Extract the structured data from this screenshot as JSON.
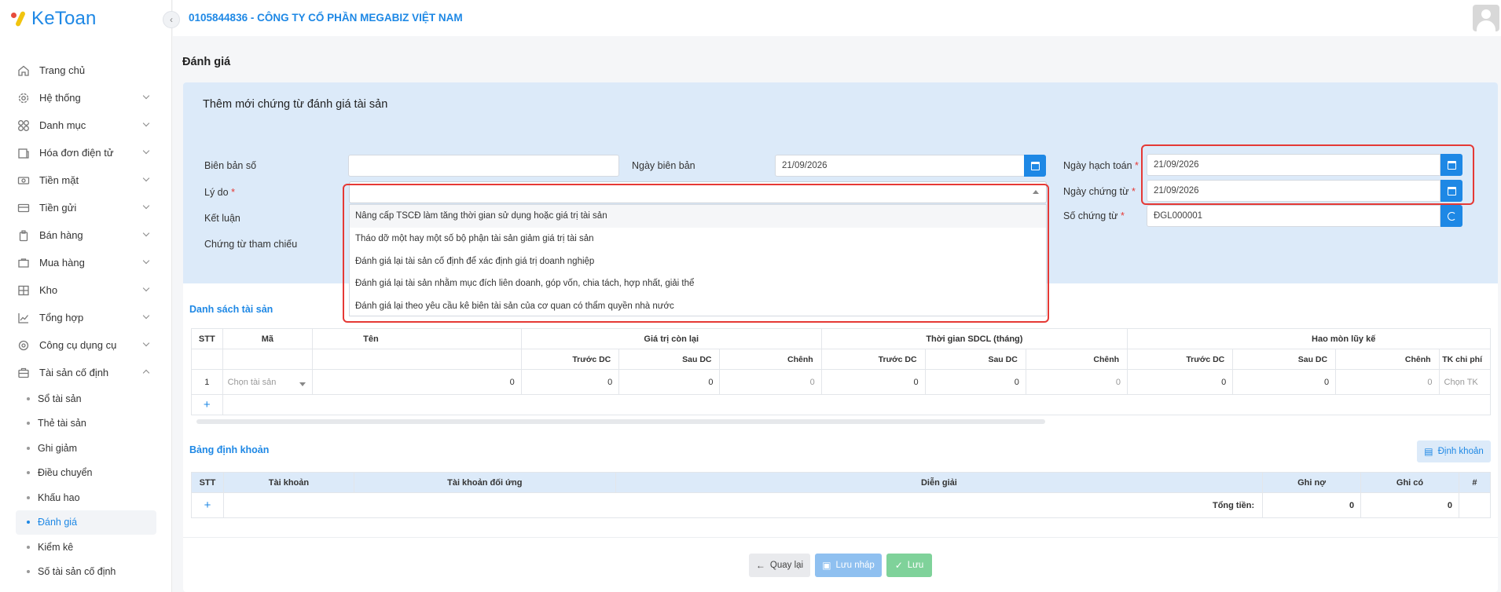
{
  "app": {
    "logo_text": "KeToan"
  },
  "header": {
    "company": "0105844836 - CÔNG TY CỔ PHẦN MEGABIZ VIỆT NAM"
  },
  "sidebar": {
    "items": [
      {
        "label": "Trang chủ",
        "icon": "home-icon"
      },
      {
        "label": "Hệ thống",
        "icon": "gear-icon"
      },
      {
        "label": "Danh mục",
        "icon": "grid-icon"
      },
      {
        "label": "Hóa đơn điện tử",
        "icon": "invoice-icon"
      },
      {
        "label": "Tiền mặt",
        "icon": "cash-icon"
      },
      {
        "label": "Tiền gửi",
        "icon": "card-icon"
      },
      {
        "label": "Bán hàng",
        "icon": "sales-icon"
      },
      {
        "label": "Mua hàng",
        "icon": "cart-icon"
      },
      {
        "label": "Kho",
        "icon": "warehouse-icon"
      },
      {
        "label": "Tổng hợp",
        "icon": "chart-icon"
      },
      {
        "label": "Công cụ dụng cụ",
        "icon": "tools-icon"
      },
      {
        "label": "Tài sản cố định",
        "icon": "asset-icon"
      }
    ],
    "subitems": [
      "Sổ tài sản",
      "Thẻ tài sản",
      "Ghi giảm",
      "Điều chuyển",
      "Khấu hao",
      "Đánh giá",
      "Kiểm kê",
      "Số tài sản cố định"
    ]
  },
  "page": {
    "title": "Đánh giá"
  },
  "form": {
    "title": "Thêm mới chứng từ đánh giá tài sản",
    "bien_ban_so": {
      "label": "Biên bản số",
      "value": ""
    },
    "ngay_bien_ban": {
      "label": "Ngày biên bản",
      "value": "21/09/2026"
    },
    "ngay_hach_toan": {
      "label": "Ngày hạch toán",
      "value": "21/09/2026"
    },
    "ly_do": {
      "label": "Lý do",
      "value": ""
    },
    "ngay_chung_tu": {
      "label": "Ngày chứng từ",
      "value": "21/09/2026"
    },
    "ket_luan": {
      "label": "Kết luận"
    },
    "so_chung_tu": {
      "label": "Số chứng từ",
      "value": "ĐGL000001"
    },
    "chung_tu_tham_chieu": {
      "label": "Chứng từ tham chiếu"
    },
    "required_mark": "*"
  },
  "dropdown": {
    "options": [
      "Nâng cấp TSCĐ làm tăng thời gian sử dụng hoặc giá trị tài sản",
      "Tháo dỡ một hay một số bộ phận tài sản giảm giá trị tài sản",
      "Đánh giá lại tài sản cố định để xác định giá trị doanh nghiệp",
      "Đánh giá lại tài sản nhằm mục đích liên doanh, góp vốn, chia tách, hợp nhất, giải thể",
      "Đánh giá lại theo yêu cầu kê biên tài sản của cơ quan có thẩm quyền nhà nước"
    ]
  },
  "assets": {
    "title": "Danh sách tài sản",
    "headers": {
      "stt": "STT",
      "ma": "Mã",
      "ten": "Tên",
      "gtcl": "Giá trị còn lại",
      "tgsdcl": "Thời gian SDCL (tháng)",
      "hmlk": "Hao mòn lũy kế"
    },
    "subheaders": {
      "truoc": "Trước DC",
      "sau": "Sau DC",
      "chenh": "Chênh",
      "tk_chi_phi": "TK chi phí"
    },
    "row": {
      "stt": "1",
      "ma_placeholder": "Chọn tài sản",
      "gtcl_truoc": "0",
      "gtcl_sau": "0",
      "gtcl_chenh": "0",
      "tg_truoc": "0",
      "tg_sau": "0",
      "tg_chenh": "0",
      "hm_truoc": "0",
      "hm_sau": "0",
      "hm_chenh": "0",
      "tk_placeholder": "Chọn TK"
    },
    "add": "+"
  },
  "entries": {
    "title": "Bảng định khoản",
    "button": "Định khoản",
    "headers": {
      "stt": "STT",
      "tai_khoan": "Tài khoản",
      "tk_doi_ung": "Tài khoản đối ứng",
      "dien_giai": "Diễn giải",
      "ghi_no": "Ghi nợ",
      "ghi_co": "Ghi có",
      "hash": "#"
    },
    "total_label": "Tổng tiền:",
    "total_no": "0",
    "total_co": "0",
    "add": "+"
  },
  "actions": {
    "back": "Quay lại",
    "draft": "Lưu nháp",
    "save": "Lưu"
  },
  "colors": {
    "primary": "#1e88e5",
    "highlight": "#e53935",
    "panel": "#dceaf9"
  }
}
